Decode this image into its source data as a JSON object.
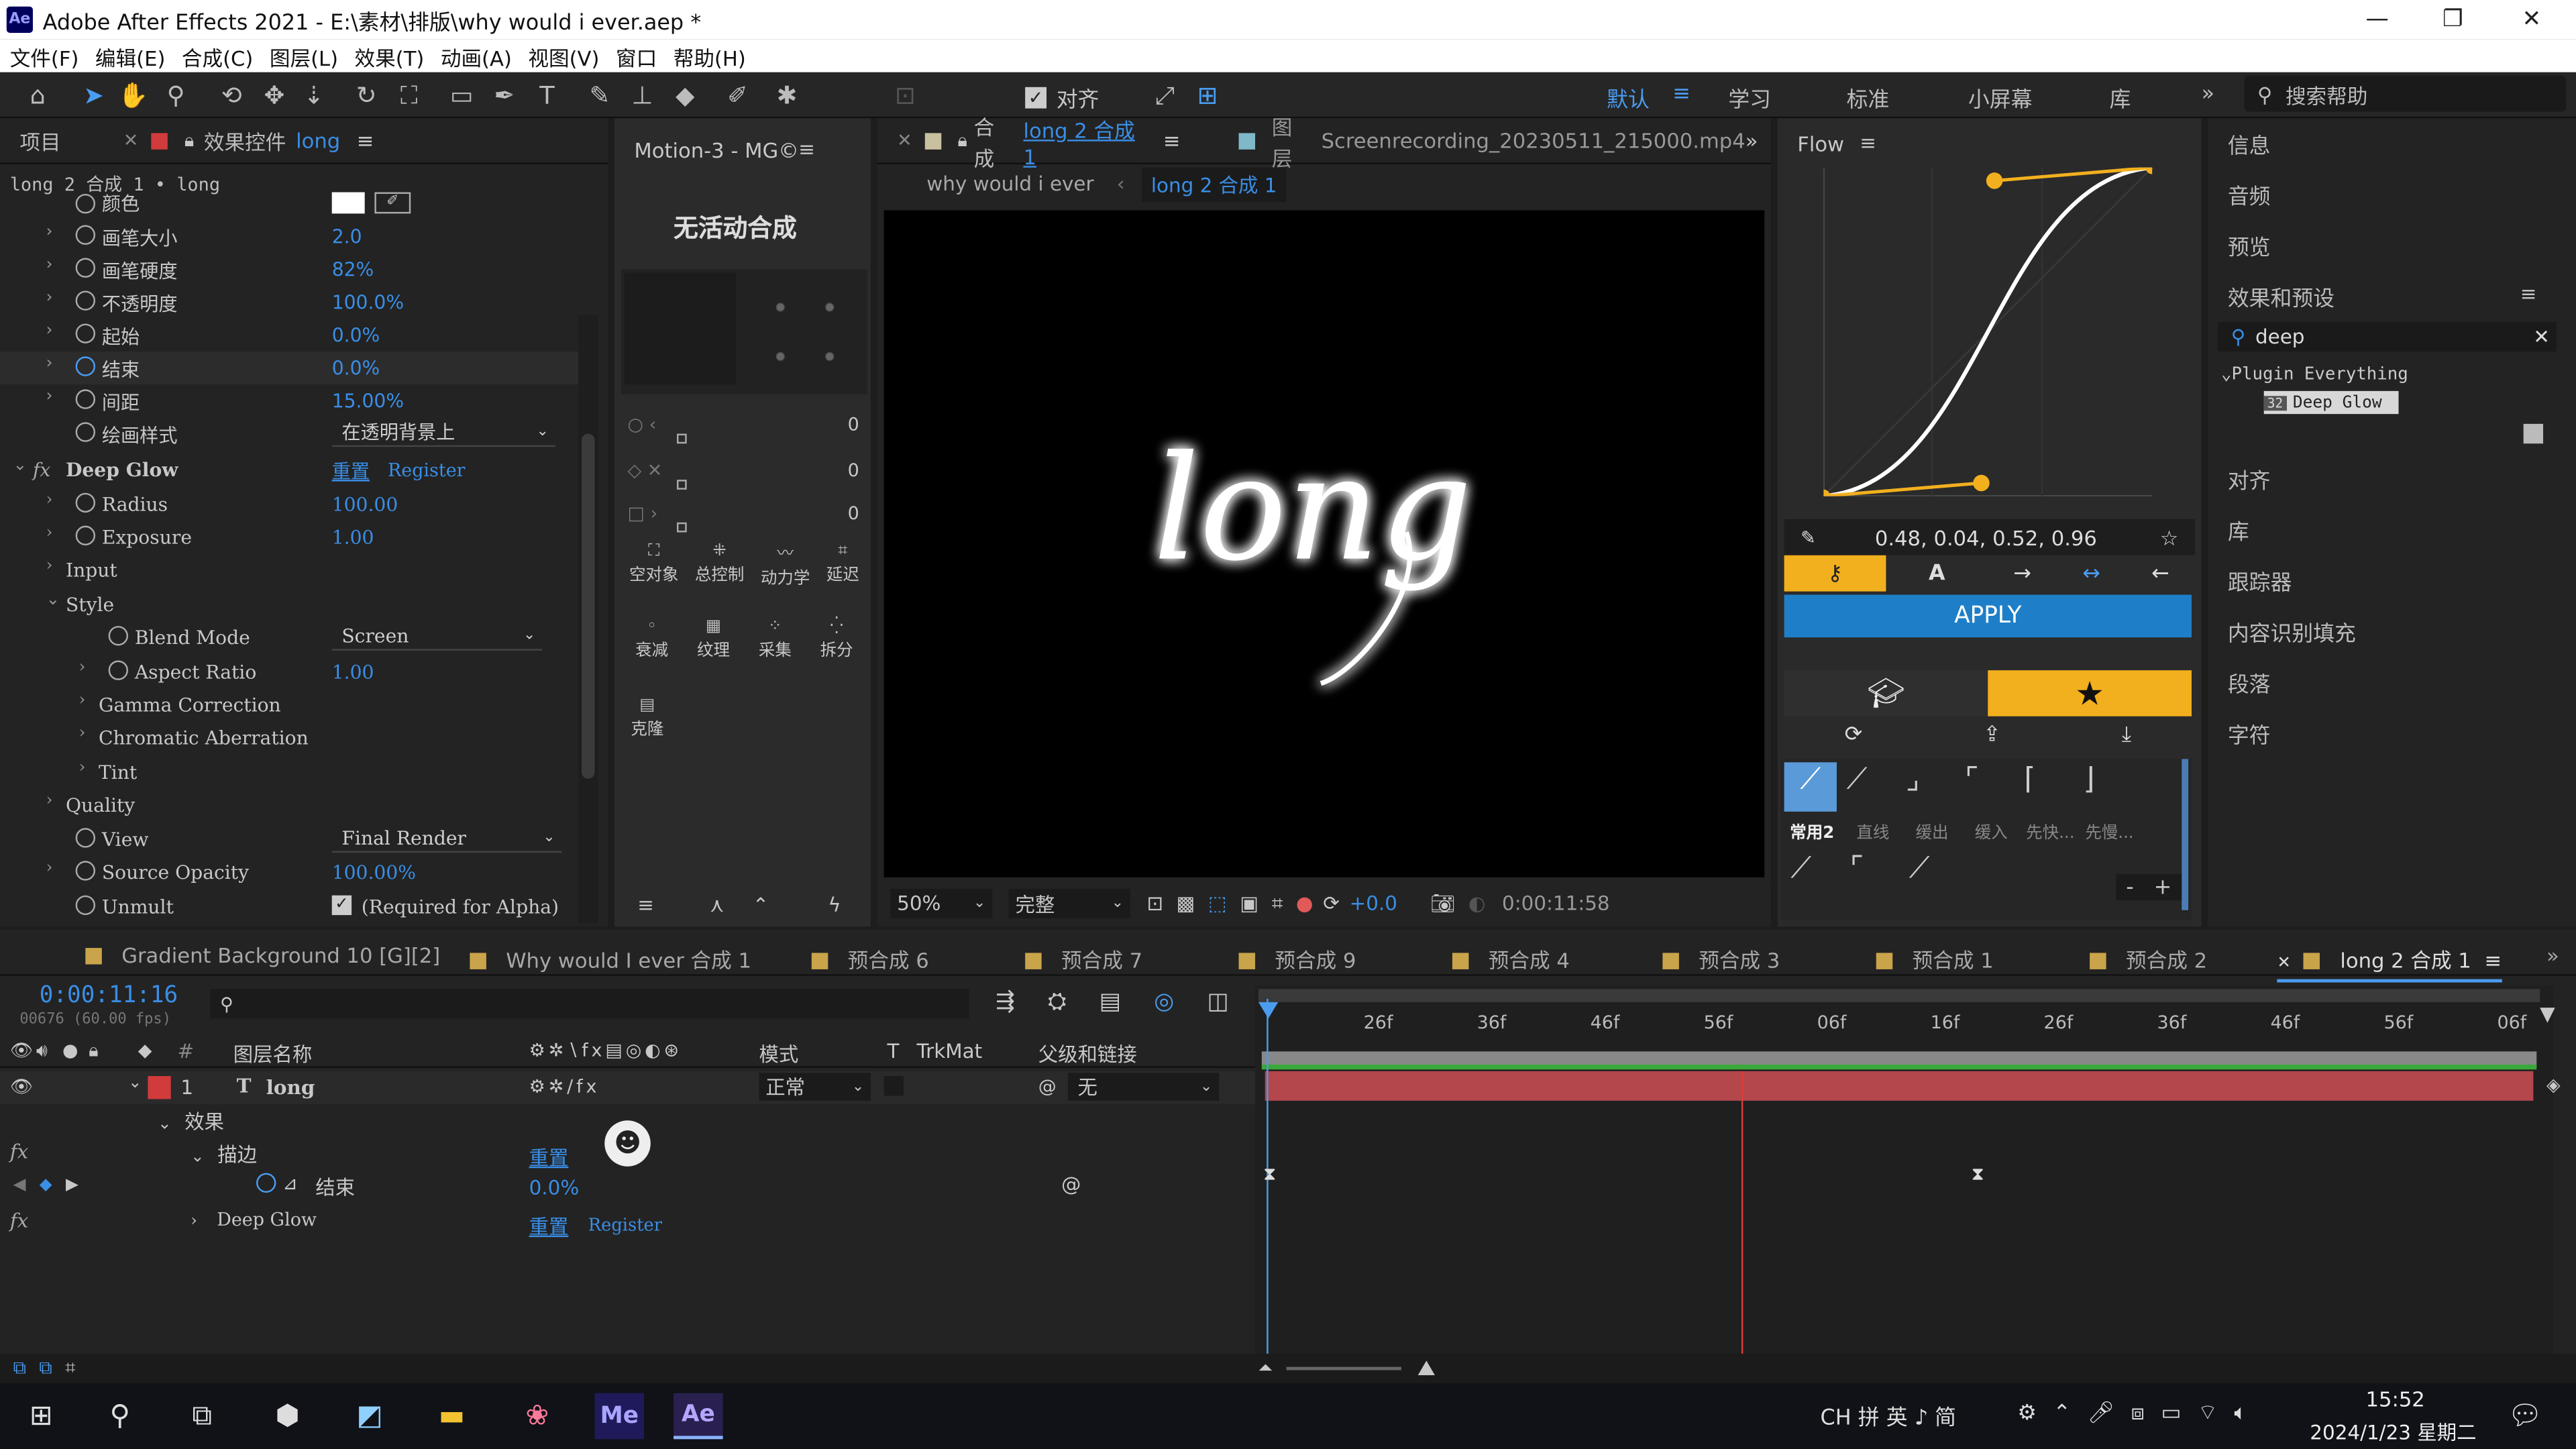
{
  "titlebar": {
    "logo": "Ae",
    "title": "Adobe After Effects 2021 - E:\\素材\\排版\\why would i ever.aep *"
  },
  "menu": [
    "文件(F)",
    "编辑(E)",
    "合成(C)",
    "图层(L)",
    "效果(T)",
    "动画(A)",
    "视图(V)",
    "窗口",
    "帮助(H)"
  ],
  "toolbar": {
    "align_label": "对齐",
    "workspaces": [
      "默认",
      "学习",
      "标准",
      "小屏幕",
      "库"
    ],
    "search_placeholder": "搜索帮助"
  },
  "effects_panel": {
    "tab_project": "项目",
    "tab_effects": "效果控件",
    "tab_effects_layer": "long",
    "breadcrumb": "long 2 合成 1 • long",
    "rows": [
      {
        "label": "颜色",
        "value": ""
      },
      {
        "label": "画笔大小",
        "value": "2.0"
      },
      {
        "label": "画笔硬度",
        "value": "82%"
      },
      {
        "label": "不透明度",
        "value": "100.0%"
      },
      {
        "label": "起始",
        "value": "0.0%"
      },
      {
        "label": "结束",
        "value": "0.0%"
      },
      {
        "label": "间距",
        "value": "15.00%"
      },
      {
        "label": "绘画样式",
        "value": "在透明背景上"
      },
      {
        "label": "Deep Glow",
        "value": "重置",
        "register": "Register"
      },
      {
        "label": "Radius",
        "value": "100.00"
      },
      {
        "label": "Exposure",
        "value": "1.00"
      },
      {
        "label": "Input",
        "value": ""
      },
      {
        "label": "Style",
        "value": ""
      },
      {
        "label": "Blend Mode",
        "value": "Screen"
      },
      {
        "label": "Aspect Ratio",
        "value": "1.00"
      },
      {
        "label": "Gamma Correction",
        "value": ""
      },
      {
        "label": "Chromatic Aberration",
        "value": ""
      },
      {
        "label": "Tint",
        "value": ""
      },
      {
        "label": "Quality",
        "value": ""
      },
      {
        "label": "View",
        "value": "Final Render"
      },
      {
        "label": "Source Opacity",
        "value": "100.00%"
      },
      {
        "label": "Unmult",
        "value": "(Required for Alpha)"
      }
    ]
  },
  "motion_panel": {
    "title": "Motion-3 - MG©",
    "no_comp": "无活动合成",
    "slider_values": [
      "0",
      "0",
      "0"
    ],
    "buttons_row1": [
      "空对象",
      "总控制",
      "动力学",
      "延迟"
    ],
    "buttons_row2": [
      "衰减",
      "纹理",
      "采集",
      "拆分"
    ],
    "buttons_row3": [
      "克隆"
    ]
  },
  "comp_panel": {
    "tab_prefix": "合成",
    "tab_name": "long 2 合成 1",
    "layer_tab_prefix": "图层",
    "layer_tab_name": "Screenrecording_20230511_215000.mp4",
    "crumb_1": "why would i ever",
    "crumb_2": "long 2 合成 1",
    "canvas_text": "long",
    "zoom": "50%",
    "quality": "完整",
    "exposure": "+0.0",
    "timecode": "0:00:11:58"
  },
  "flow_panel": {
    "title": "Flow",
    "bezier": "0.48, 0.04, 0.52, 0.96",
    "apply": "APPLY",
    "presets": [
      "常用2",
      "直线",
      "缓出",
      "缓入",
      "先快...",
      "先慢..."
    ],
    "curve_ctrl": [
      0.48,
      0.04,
      0.52,
      0.96
    ],
    "minus": "-",
    "plus": "+"
  },
  "right_panel": {
    "items_top": [
      "信息",
      "音频",
      "预览",
      "效果和预设"
    ],
    "search_value": "deep",
    "tree_folder": "Plugin Everything",
    "tree_item": "Deep Glow",
    "items_bottom": [
      "对齐",
      "库",
      "跟踪器",
      "内容识别填充",
      "段落",
      "字符"
    ]
  },
  "timeline": {
    "tabs": [
      "Gradient Background 10 [G][2]",
      "Why would I ever 合成 1",
      "预合成 6",
      "预合成 7",
      "预合成 9",
      "预合成 4",
      "预合成 3",
      "预合成 1",
      "预合成 2"
    ],
    "active_tab": "long 2 合成 1",
    "timecode": "0:00:11:16",
    "frames": "00676 (60.00 fps)",
    "col_name": "图层名称",
    "col_mode": "模式",
    "col_t": "T",
    "col_trkmat": "TrkMat",
    "col_parent": "父级和链接",
    "layer_index": "1",
    "layer_name": "long",
    "layer_mode": "正常",
    "layer_parent": "无",
    "effects_label": "效果",
    "stroke_label": "描边",
    "reset": "重置",
    "end_label": "结束",
    "end_value": "0.0%",
    "deep_glow": "Deep Glow",
    "register": "Register",
    "ruler": [
      "26f",
      "36f",
      "46f",
      "56f",
      "06f",
      "16f",
      "26f",
      "36f",
      "46f",
      "56f",
      "06f"
    ]
  },
  "taskbar": {
    "app_me": "Me",
    "app_ae": "Ae",
    "tray": "CH 拼 英 ♪ 简",
    "time": "15:52",
    "date": "2024/1/23 星期二"
  },
  "colors": {
    "accent_blue": "#3a8ee6",
    "flow_yellow": "#f2b01e",
    "apply_blue": "#1e7fc8",
    "layer_red": "#b3474c"
  }
}
